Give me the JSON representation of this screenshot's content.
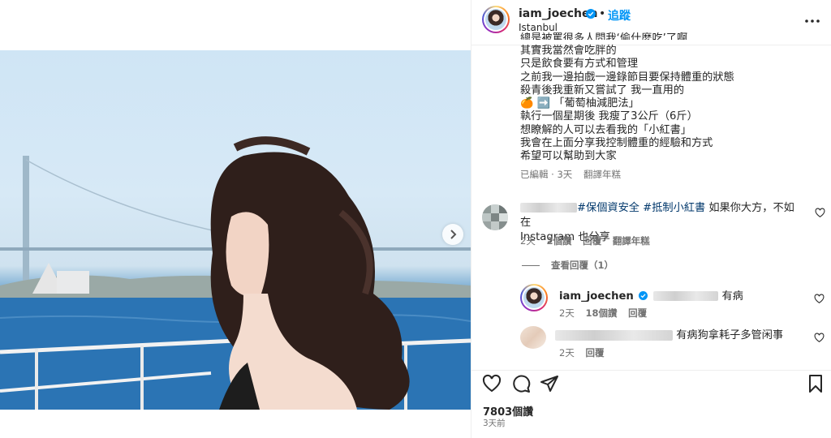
{
  "header": {
    "username": "iam_joechen",
    "follow_dot": "•",
    "follow_label": "追蹤",
    "location": "Istanbul"
  },
  "caption": {
    "lines": [
      "總是被罵很多人問我‘偷什麼吃’了啊",
      "其實我當然會吃胖的",
      "只是飲食要有方式和管理",
      "之前我一邊拍戲一邊錄節目要保持體重的狀態",
      "殺青後我重新又嘗試了 我一直用的",
      "「葡萄柚減肥法」",
      "執行一個星期後 我瘦了3公斤（6斤）",
      "想瞭解的人可以去看我的「小紅書」",
      "我會在上面分享我控制體重的經驗和方式",
      "希望可以幫助到大家"
    ],
    "emoji_line_prefix": "🍊 ➡️",
    "meta": {
      "edited": "已編輯 · 3天",
      "translate": "翻譯年糕"
    }
  },
  "comments": [
    {
      "hashtags": "#保個資安全 #抵制小紅書",
      "text_after": " 如果你大方，不如在",
      "text_line2": "Instagram 也分享",
      "time": "2天",
      "likes": "2個讚",
      "reply": "回覆",
      "translate": "翻譯年糕"
    }
  ],
  "view_replies": "查看回覆（1）",
  "replies": [
    {
      "username": "iam_joechen",
      "text": "有病",
      "time": "2天",
      "likes": "18個讚",
      "reply": "回覆"
    },
    {
      "text": "有病狗拿耗子多管闲事",
      "time": "2天",
      "reply": "回覆"
    }
  ],
  "footer": {
    "likes": "7803個讚",
    "date": "3天前"
  },
  "icons": {
    "more": "more-horizontal-icon",
    "next": "chevron-right-icon",
    "like": "heart-icon",
    "comment": "comment-bubble-icon",
    "share": "paper-plane-icon",
    "save": "bookmark-icon"
  },
  "colors": {
    "link": "#0095f6",
    "hashtag": "#00376b",
    "muted": "#737373"
  }
}
